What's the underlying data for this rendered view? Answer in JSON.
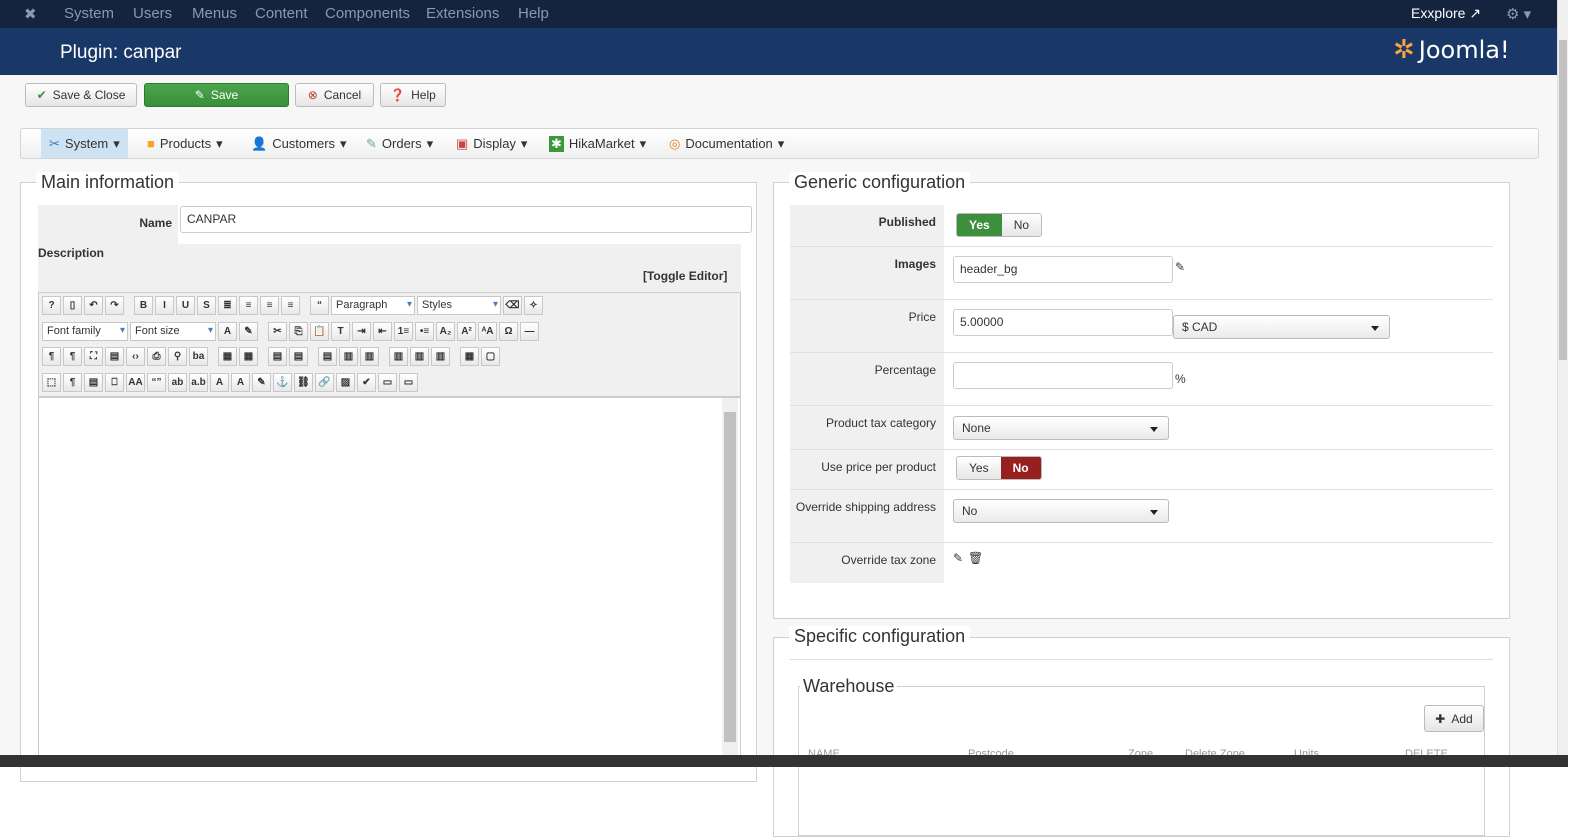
{
  "topnav": {
    "items": [
      "System",
      "Users",
      "Menus",
      "Content",
      "Components",
      "Extensions",
      "Help"
    ],
    "explore": "Exxplore"
  },
  "header": {
    "title": "Plugin: canpar",
    "logo": "Joomla!"
  },
  "toolbar": {
    "save_close": "Save & Close",
    "save": "Save",
    "cancel": "Cancel",
    "help": "Help"
  },
  "menu": [
    {
      "label": "System",
      "icon": "tools-icon"
    },
    {
      "label": "Products",
      "icon": "box-icon"
    },
    {
      "label": "Customers",
      "icon": "user-icon"
    },
    {
      "label": "Orders",
      "icon": "order-icon"
    },
    {
      "label": "Display",
      "icon": "display-icon"
    },
    {
      "label": "HikaMarket",
      "icon": "hikamarket-icon"
    },
    {
      "label": "Documentation",
      "icon": "lifebuoy-icon"
    }
  ],
  "main": {
    "legend": "Main information",
    "name_label": "Name",
    "name_value": "CANPAR",
    "description_label": "Description",
    "toggle_editor": "[Toggle Editor]",
    "editor": {
      "paragraph": "Paragraph",
      "styles": "Styles",
      "font_family": "Font family",
      "font_size": "Font size",
      "row1": [
        "help",
        "new-document",
        "undo",
        "redo",
        "|",
        "B",
        "I",
        "U",
        "S",
        "justify",
        "center",
        "left",
        "right",
        "|",
        "blockquote"
      ],
      "row1b": [
        "eraser",
        "cleanup"
      ],
      "row2": [
        "font-color",
        "highlight",
        "|",
        "cut",
        "copy",
        "paste",
        "paste-text",
        "indent",
        "outdent",
        "ordered-list",
        "unordered-list",
        "subscript",
        "superscript",
        "text-direction",
        "special-char",
        "hr"
      ],
      "row3": [
        "ltr",
        "rtl",
        "fullscreen",
        "preview",
        "code",
        "print",
        "find",
        "replace",
        "|",
        "table",
        "delete-table",
        "|",
        "row-before",
        "row-after",
        "|",
        "insert-row",
        "insert-col",
        "delete-col",
        "|",
        "col-before",
        "col-after",
        "col-delete",
        "|",
        "merge",
        "split"
      ],
      "row4": [
        "visual-aid",
        "show-blocks",
        "template",
        "page-break",
        "styles",
        "cite",
        "abbr",
        "acronym",
        "del",
        "ins",
        "attribs",
        "anchor",
        "unlink",
        "link",
        "image",
        "spellcheck",
        "layer",
        "layer2"
      ]
    }
  },
  "generic": {
    "legend": "Generic configuration",
    "published": {
      "label": "Published",
      "yes": "Yes",
      "no": "No"
    },
    "images": {
      "label": "Images",
      "value": "header_bg"
    },
    "price": {
      "label": "Price",
      "value": "5.00000",
      "currency": "$ CAD"
    },
    "percentage": {
      "label": "Percentage",
      "value": "",
      "suffix": "%"
    },
    "tax_category": {
      "label": "Product tax category",
      "value": "None"
    },
    "price_per_product": {
      "label": "Use price per product",
      "yes": "Yes",
      "no": "No"
    },
    "override_shipping": {
      "label": "Override shipping address",
      "value": "No"
    },
    "override_tax_zone": {
      "label": "Override tax zone"
    }
  },
  "specific": {
    "legend": "Specific configuration",
    "warehouse": {
      "legend": "Warehouse",
      "add": "Add",
      "columns": [
        "NAME",
        "Postcode",
        "Zone",
        "Delete Zone",
        "Units",
        "DELETE"
      ]
    }
  },
  "colors": {
    "nav": "#14233e",
    "header": "#1a3867",
    "green": "#3d8f3d",
    "red": "#962020"
  }
}
